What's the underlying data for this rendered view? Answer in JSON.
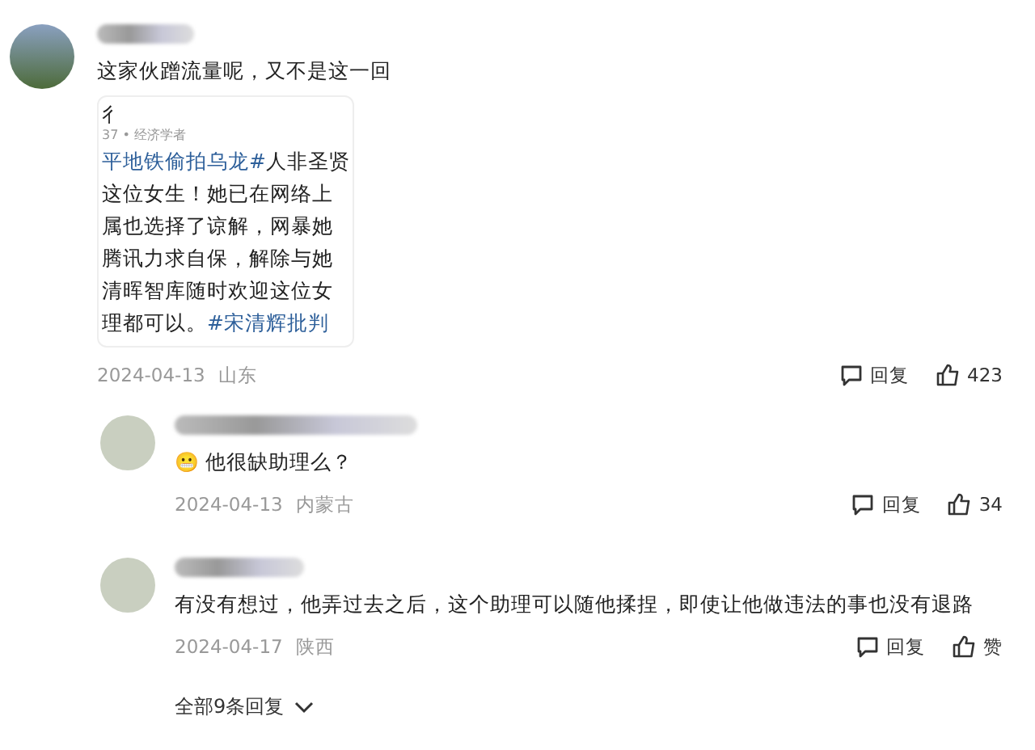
{
  "comment": {
    "text": "这家伙蹭流量呢，又不是这一回",
    "quote_card": {
      "title": "彳",
      "meta": "37 • 经济学者",
      "lines": [
        [
          {
            "text": "平地铁偷拍乌龙#",
            "link": true
          },
          {
            "text": "人非圣贤",
            "link": false
          }
        ],
        [
          {
            "text": "这位女生！她已在网络上",
            "link": false
          }
        ],
        [
          {
            "text": "属也选择了谅解，网暴她",
            "link": false
          }
        ],
        [
          {
            "text": "腾讯力求自保，解除与她",
            "link": false
          }
        ],
        [
          {
            "text": "清晖智库随时欢迎这位女",
            "link": false
          }
        ],
        [
          {
            "text": "理都可以。",
            "link": false
          },
          {
            "text": "#宋清辉批判",
            "link": true
          }
        ]
      ]
    },
    "date": "2024-04-13",
    "location": "山东",
    "reply_label": "回复",
    "likes": "423"
  },
  "replies": [
    {
      "emoji": "😬",
      "text": "他很缺助理么？",
      "date": "2024-04-13",
      "location": "内蒙古",
      "reply_label": "回复",
      "likes": "34"
    },
    {
      "text": "有没有想过，他弄过去之后，这个助理可以随他揉捏，即使让他做违法的事也没有退路",
      "date": "2024-04-17",
      "location": "陕西",
      "reply_label": "回复",
      "likes": "赞"
    }
  ],
  "more_replies": "全部9条回复"
}
